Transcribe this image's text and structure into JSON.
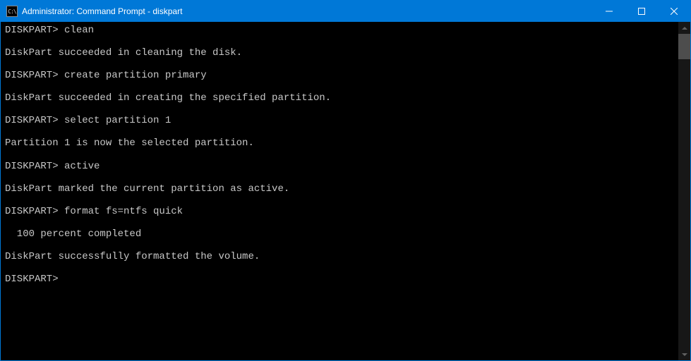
{
  "titlebar": {
    "icon_label": "C:\\",
    "title": "Administrator: Command Prompt - diskpart"
  },
  "terminal": {
    "prompt": "DISKPART>",
    "lines": [
      {
        "type": "cmd",
        "text": "DISKPART> clean"
      },
      {
        "type": "blank",
        "text": ""
      },
      {
        "type": "out",
        "text": "DiskPart succeeded in cleaning the disk."
      },
      {
        "type": "blank",
        "text": ""
      },
      {
        "type": "cmd",
        "text": "DISKPART> create partition primary"
      },
      {
        "type": "blank",
        "text": ""
      },
      {
        "type": "out",
        "text": "DiskPart succeeded in creating the specified partition."
      },
      {
        "type": "blank",
        "text": ""
      },
      {
        "type": "cmd",
        "text": "DISKPART> select partition 1"
      },
      {
        "type": "blank",
        "text": ""
      },
      {
        "type": "out",
        "text": "Partition 1 is now the selected partition."
      },
      {
        "type": "blank",
        "text": ""
      },
      {
        "type": "cmd",
        "text": "DISKPART> active"
      },
      {
        "type": "blank",
        "text": ""
      },
      {
        "type": "out",
        "text": "DiskPart marked the current partition as active."
      },
      {
        "type": "blank",
        "text": ""
      },
      {
        "type": "cmd",
        "text": "DISKPART> format fs=ntfs quick"
      },
      {
        "type": "blank",
        "text": ""
      },
      {
        "type": "out",
        "text": "  100 percent completed"
      },
      {
        "type": "blank",
        "text": ""
      },
      {
        "type": "out",
        "text": "DiskPart successfully formatted the volume."
      },
      {
        "type": "blank",
        "text": ""
      },
      {
        "type": "cmd",
        "text": "DISKPART>"
      }
    ]
  }
}
